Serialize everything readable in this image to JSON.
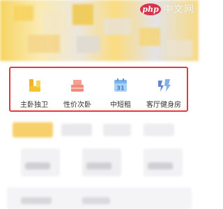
{
  "banner": {
    "watermark_logo": "php",
    "watermark_text": "中文网"
  },
  "categories": [
    {
      "label": "主卧独卫",
      "icon": "bedroom-bathroom-icon",
      "color": "#f5c332"
    },
    {
      "label": "性价次卧",
      "icon": "bed-icon",
      "color": "#f28b7a"
    },
    {
      "label": "中短租",
      "icon": "calendar-icon",
      "color": "#7ab2ea"
    },
    {
      "label": "客厅健身房",
      "icon": "gym-icon",
      "color": "#5b86d8"
    }
  ],
  "calendar_number": "31",
  "colors": {
    "highlight_border": "#e23a3a",
    "accent_yellow": "#f5c332"
  }
}
